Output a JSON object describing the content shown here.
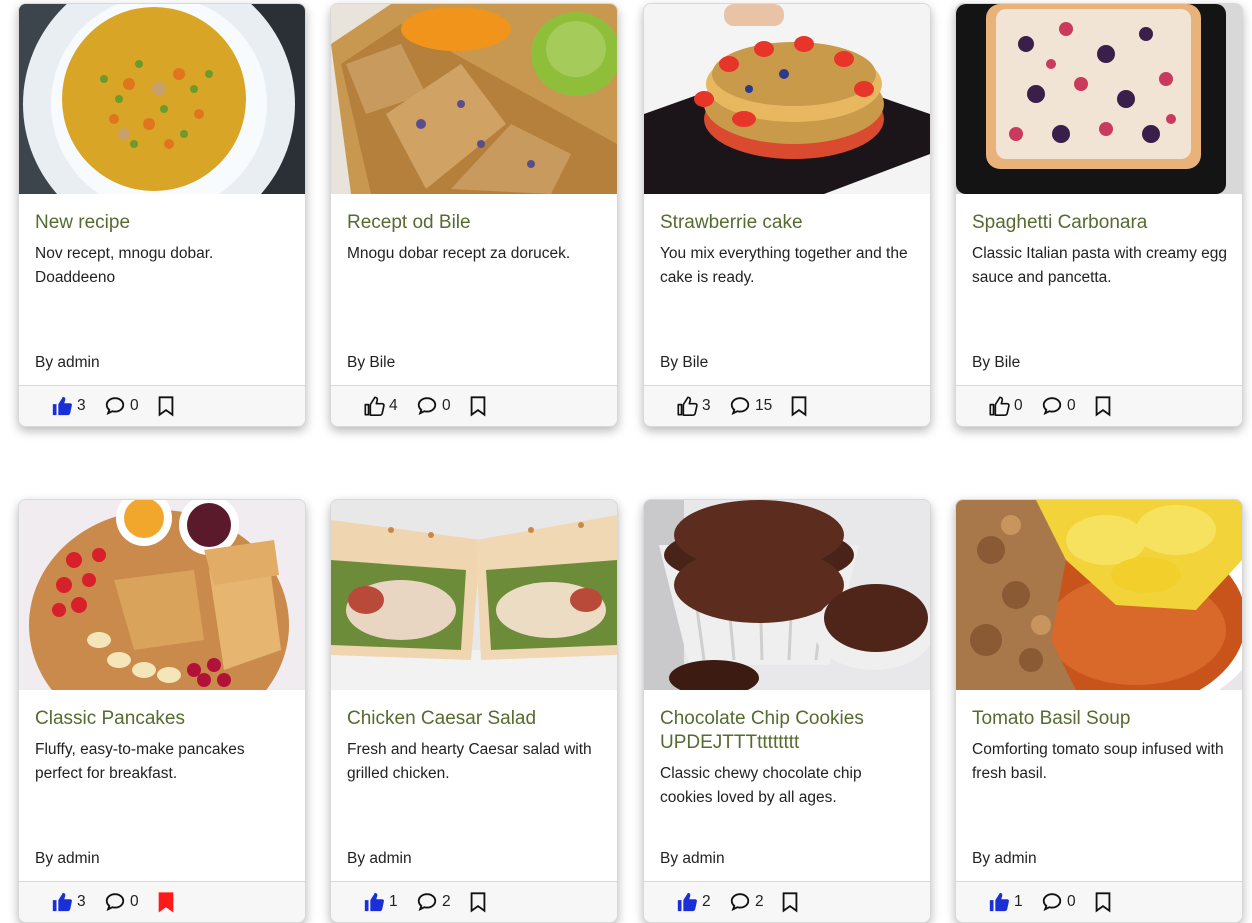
{
  "colors": {
    "title": "#556b2f",
    "liked": "#1a2fd6",
    "bookmarked": "#ff1a1a",
    "outline": "#111111"
  },
  "recipes": [
    {
      "title": "New recipe",
      "description": "Nov recept, mnogu dobar. Doaddeeno",
      "author": "By admin",
      "likes": "3",
      "comments": "0",
      "liked": true,
      "bookmarked": false,
      "image": "yellow-curry-soup-bowl"
    },
    {
      "title": "Recept od Bile",
      "description": "Mnogu dobar recept za dorucek.",
      "author": "By Bile",
      "likes": "4",
      "comments": "0",
      "liked": false,
      "bookmarked": false,
      "image": "oat-bars-on-wooden-board"
    },
    {
      "title": "Strawberrie cake",
      "description": "You mix everything together and the cake is ready.",
      "author": "By Bile",
      "likes": "3",
      "comments": "15",
      "liked": false,
      "bookmarked": false,
      "image": "strawberry-layer-cake"
    },
    {
      "title": "Spaghetti Carbonara",
      "description": "Classic Italian pasta with creamy egg sauce and pancetta.",
      "author": "By Bile",
      "likes": "0",
      "comments": "0",
      "liked": false,
      "bookmarked": false,
      "image": "berry-tray-bake"
    },
    {
      "title": "Classic Pancakes",
      "description": "Fluffy, easy-to-make pancakes perfect for breakfast.",
      "author": "By admin",
      "likes": "3",
      "comments": "0",
      "liked": true,
      "bookmarked": true,
      "image": "crepes-platter-with-fruit"
    },
    {
      "title": "Chicken Caesar Salad",
      "description": "Fresh and hearty Caesar salad with grilled chicken.",
      "author": "By admin",
      "likes": "1",
      "comments": "2",
      "liked": true,
      "bookmarked": false,
      "image": "chicken-wrap-halves"
    },
    {
      "title": "Chocolate Chip Cookies UPDEJTTTtttttttt",
      "description": "Classic chewy chocolate chip cookies loved by all ages.",
      "author": "By admin",
      "likes": "2",
      "comments": "2",
      "liked": true,
      "bookmarked": false,
      "image": "chocolate-muffins"
    },
    {
      "title": "Tomato Basil Soup",
      "description": "Comforting tomato soup infused with fresh basil.",
      "author": "By admin",
      "likes": "1",
      "comments": "0",
      "liked": true,
      "bookmarked": false,
      "image": "stew-with-mashed-potatoes"
    }
  ]
}
